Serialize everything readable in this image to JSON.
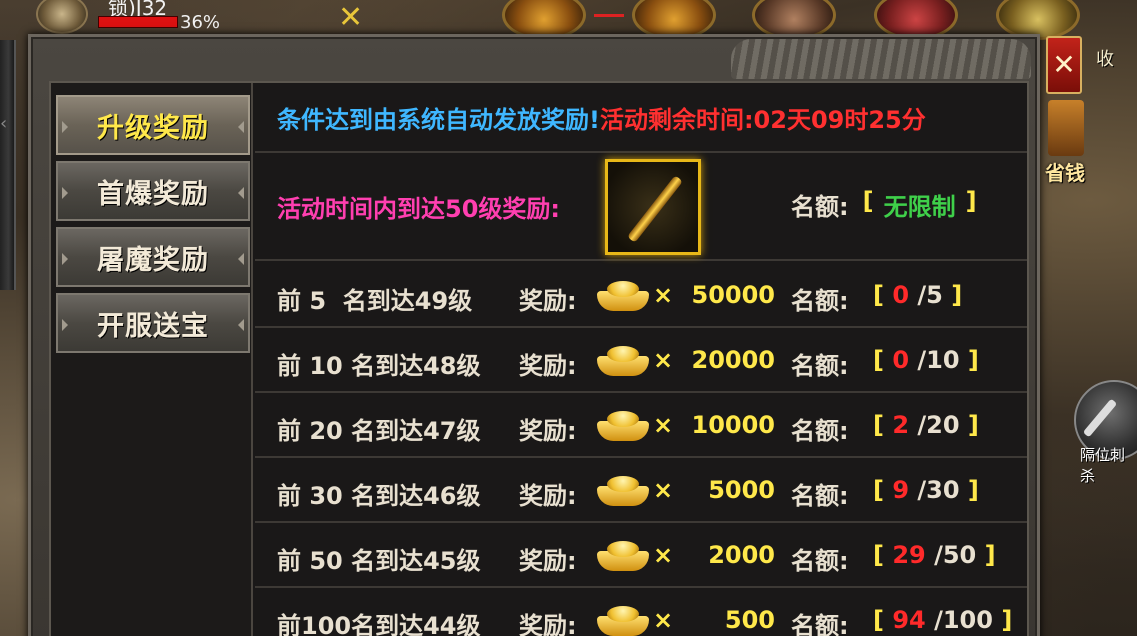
{
  "hud": {
    "name": "锁)J32",
    "hp_percent": "36%",
    "hp_fraction": 0.36,
    "close_symbol": "✕"
  },
  "side": {
    "top_label": "收",
    "save_label": "省钱",
    "skill_label": "隔位刺杀"
  },
  "panel": {
    "close_label": "✕",
    "tabs": [
      {
        "label": "升级奖励",
        "active": true
      },
      {
        "label": "首爆奖励",
        "active": false
      },
      {
        "label": "屠魔奖励",
        "active": false
      },
      {
        "label": "开服送宝",
        "active": false
      }
    ],
    "notice": {
      "auto_text": "条件达到由系统自动发放奖励!",
      "remaining_text": "活动剩余时间:02天09时25分"
    },
    "top_reward": {
      "label": "活动时间内到达50级奖励:",
      "item_icon": "golden-rod-icon",
      "quota_label": "名额:",
      "bracket_open": "[",
      "quota_value": "无限制",
      "bracket_close": "]"
    },
    "reward_label": "奖励:",
    "times_symbol": "×",
    "quota_label": "名额:",
    "rows": [
      {
        "condition": "前 5  名到达49级",
        "amount": "50000",
        "claimed": "0",
        "total": "5"
      },
      {
        "condition": "前 10 名到达48级",
        "amount": "20000",
        "claimed": "0",
        "total": "10"
      },
      {
        "condition": "前 20 名到达47级",
        "amount": "10000",
        "claimed": "2",
        "total": "20"
      },
      {
        "condition": "前 30 名到达46级",
        "amount": "5000",
        "claimed": "9",
        "total": "30"
      },
      {
        "condition": "前 50 名到达45级",
        "amount": "2000",
        "claimed": "29",
        "total": "50"
      },
      {
        "condition": "前100名到达44级",
        "amount": "500",
        "claimed": "94",
        "total": "100"
      }
    ]
  },
  "colors": {
    "blue_text": "#3fb7ff",
    "red_text": "#ff3030",
    "pink_text": "#ff3fb0",
    "yellow_text": "#ffe84a",
    "green_text": "#3fd04a"
  }
}
